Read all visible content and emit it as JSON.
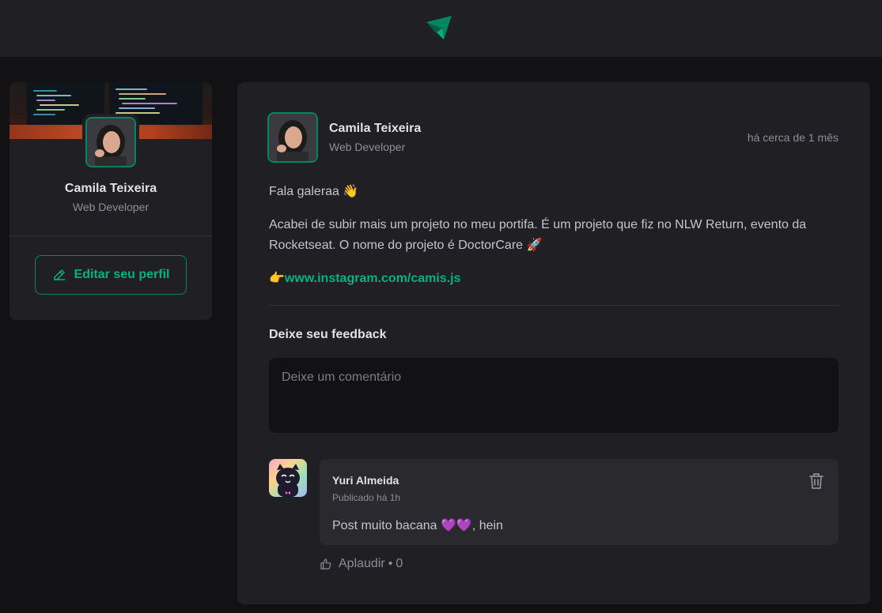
{
  "header": {
    "logo_icon": "paper-plane-logo-icon",
    "brand_color": "#00b37e"
  },
  "sidebar": {
    "name": "Camila Teixeira",
    "role": "Web Developer",
    "edit_button_label": "Editar seu perfil",
    "edit_icon": "pencil-icon"
  },
  "post": {
    "author_name": "Camila Teixeira",
    "author_role": "Web Developer",
    "published": "há cerca de 1 mês",
    "content": [
      "Fala galeraa 👋",
      "Acabei de subir mais um projeto no meu portifa. É um projeto que fiz no NLW Return, evento da Rocketseat. O nome do projeto é DoctorCare 🚀"
    ],
    "link_emoji": "👉",
    "link_text": "www.instagram.com/camis.js",
    "feedback_title": "Deixe seu feedback",
    "comment_placeholder": "Deixe um comentário"
  },
  "comments": [
    {
      "author": "Yuri Almeida",
      "published": "Publicado há 1h",
      "text": "Post muito bacana 💜💜, hein",
      "applaud_label": "Aplaudir",
      "applaud_separator": "•",
      "applaud_count": "0"
    }
  ]
}
